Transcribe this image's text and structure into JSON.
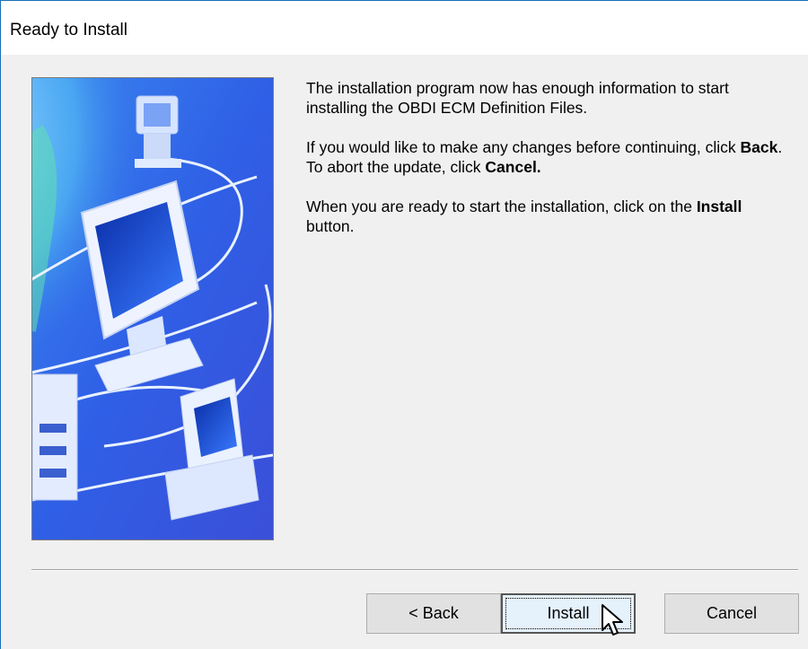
{
  "window": {
    "title": "Ready to Install"
  },
  "body": {
    "p1": "The installation program now has enough information to start installing the OBDI ECM Definition Files.",
    "p2_a": "If you would like to make any changes before continuing, click ",
    "p2_b": "Back",
    "p2_c": ". To abort the update, click ",
    "p2_d": "Cancel.",
    "p3_a": "When you are ready to start the installation, click on the ",
    "p3_b": "Install",
    "p3_c": " button."
  },
  "buttons": {
    "back": "< Back",
    "install": "Install",
    "cancel": "Cancel"
  },
  "colors": {
    "graphic_bg": "#2e63e0",
    "accent_border": "#1a6fb8"
  }
}
